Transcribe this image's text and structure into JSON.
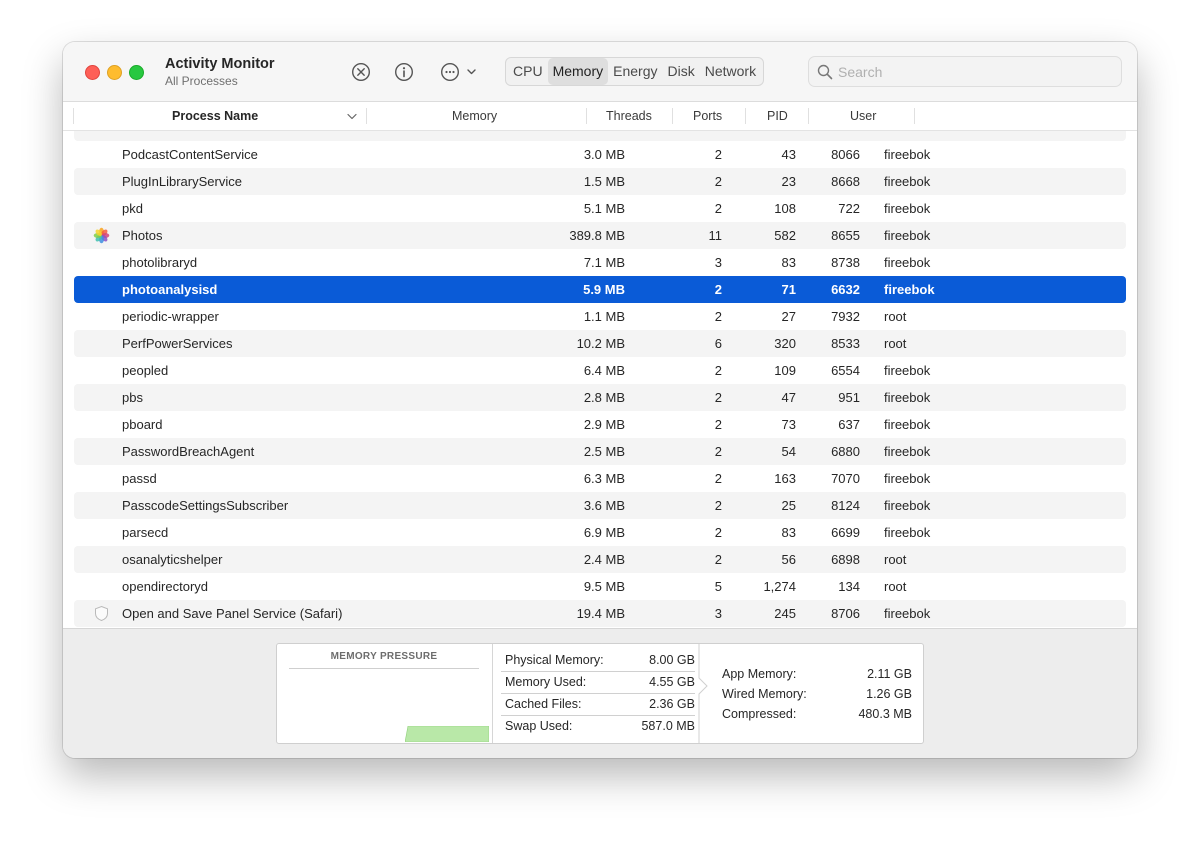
{
  "window": {
    "title": "Activity Monitor",
    "subtitle": "All Processes"
  },
  "toolbar": {
    "tabs": [
      "CPU",
      "Memory",
      "Energy",
      "Disk",
      "Network"
    ],
    "active_tab": "Memory",
    "search_placeholder": "Search"
  },
  "columns": {
    "process_name": "Process Name",
    "memory": "Memory",
    "threads": "Threads",
    "ports": "Ports",
    "pid": "PID",
    "user": "User"
  },
  "processes": [
    {
      "name": "PodcastContentService",
      "memory": "3.0 MB",
      "threads": "2",
      "ports": "43",
      "pid": "8066",
      "user": "fireebok",
      "icon": ""
    },
    {
      "name": "PlugInLibraryService",
      "memory": "1.5 MB",
      "threads": "2",
      "ports": "23",
      "pid": "8668",
      "user": "fireebok",
      "icon": ""
    },
    {
      "name": "pkd",
      "memory": "5.1 MB",
      "threads": "2",
      "ports": "108",
      "pid": "722",
      "user": "fireebok",
      "icon": ""
    },
    {
      "name": "Photos",
      "memory": "389.8 MB",
      "threads": "11",
      "ports": "582",
      "pid": "8655",
      "user": "fireebok",
      "icon": "photos-app-icon"
    },
    {
      "name": "photolibraryd",
      "memory": "7.1 MB",
      "threads": "3",
      "ports": "83",
      "pid": "8738",
      "user": "fireebok",
      "icon": ""
    },
    {
      "name": "photoanalysisd",
      "memory": "5.9 MB",
      "threads": "2",
      "ports": "71",
      "pid": "6632",
      "user": "fireebok",
      "icon": "",
      "selected": true
    },
    {
      "name": "periodic-wrapper",
      "memory": "1.1 MB",
      "threads": "2",
      "ports": "27",
      "pid": "7932",
      "user": "root",
      "icon": ""
    },
    {
      "name": "PerfPowerServices",
      "memory": "10.2 MB",
      "threads": "6",
      "ports": "320",
      "pid": "8533",
      "user": "root",
      "icon": ""
    },
    {
      "name": "peopled",
      "memory": "6.4 MB",
      "threads": "2",
      "ports": "109",
      "pid": "6554",
      "user": "fireebok",
      "icon": ""
    },
    {
      "name": "pbs",
      "memory": "2.8 MB",
      "threads": "2",
      "ports": "47",
      "pid": "951",
      "user": "fireebok",
      "icon": ""
    },
    {
      "name": "pboard",
      "memory": "2.9 MB",
      "threads": "2",
      "ports": "73",
      "pid": "637",
      "user": "fireebok",
      "icon": ""
    },
    {
      "name": "PasswordBreachAgent",
      "memory": "2.5 MB",
      "threads": "2",
      "ports": "54",
      "pid": "6880",
      "user": "fireebok",
      "icon": ""
    },
    {
      "name": "passd",
      "memory": "6.3 MB",
      "threads": "2",
      "ports": "163",
      "pid": "7070",
      "user": "fireebok",
      "icon": ""
    },
    {
      "name": "PasscodeSettingsSubscriber",
      "memory": "3.6 MB",
      "threads": "2",
      "ports": "25",
      "pid": "8124",
      "user": "fireebok",
      "icon": ""
    },
    {
      "name": "parsecd",
      "memory": "6.9 MB",
      "threads": "2",
      "ports": "83",
      "pid": "6699",
      "user": "fireebok",
      "icon": ""
    },
    {
      "name": "osanalyticshelper",
      "memory": "2.4 MB",
      "threads": "2",
      "ports": "56",
      "pid": "6898",
      "user": "root",
      "icon": ""
    },
    {
      "name": "opendirectoryd",
      "memory": "9.5 MB",
      "threads": "5",
      "ports": "1,274",
      "pid": "134",
      "user": "root",
      "icon": ""
    },
    {
      "name": "Open and Save Panel Service (Safari)",
      "memory": "19.4 MB",
      "threads": "3",
      "ports": "245",
      "pid": "8706",
      "user": "fireebok",
      "icon": "shield-icon"
    }
  ],
  "memory_pressure": {
    "title": "MEMORY PRESSURE",
    "color": "#b9e8a8"
  },
  "stats": [
    {
      "label": "Physical Memory:",
      "value": "8.00 GB"
    },
    {
      "label": "Memory Used:",
      "value": "4.55 GB"
    },
    {
      "label": "Cached Files:",
      "value": "2.36 GB"
    },
    {
      "label": "Swap Used:",
      "value": "587.0 MB"
    }
  ],
  "app_stats": [
    {
      "label": "App Memory:",
      "value": "2.11 GB"
    },
    {
      "label": "Wired Memory:",
      "value": "1.26 GB"
    },
    {
      "label": "Compressed:",
      "value": "480.3 MB"
    }
  ],
  "colors": {
    "selection": "#0a5bd7",
    "close": "#fe5f57",
    "minimize": "#febc2e",
    "zoom": "#28c840"
  }
}
